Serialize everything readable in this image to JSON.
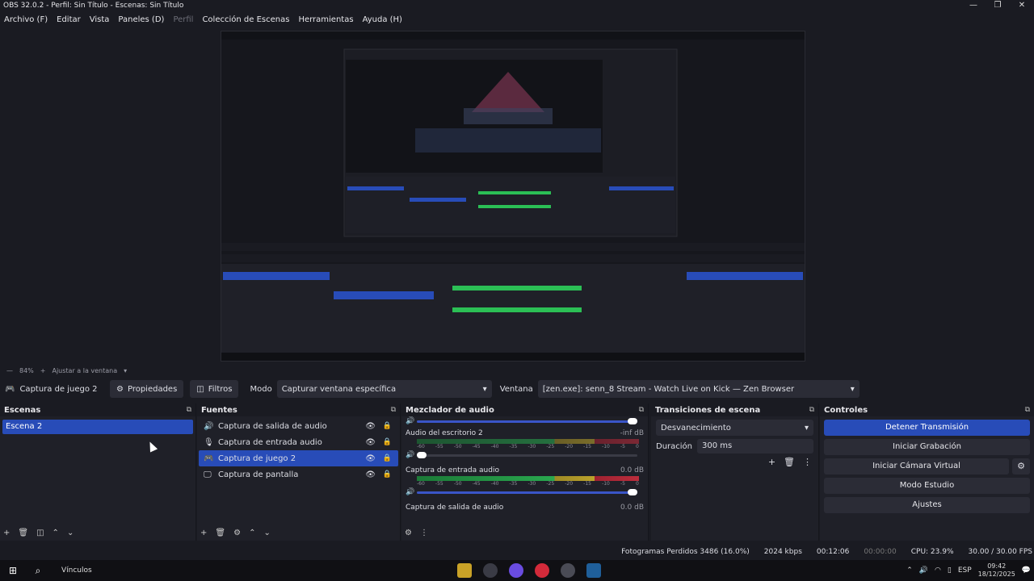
{
  "window": {
    "title": "OBS 32.0.2 - Perfil: Sin Título - Escenas: Sin Título",
    "controls": [
      "—",
      "❐",
      "✕"
    ]
  },
  "menu": [
    "Archivo (F)",
    "Editar",
    "Vista",
    "Paneles (D)",
    "Perfil",
    "Colección de Escenas",
    "Herramientas",
    "Ayuda (H)"
  ],
  "zoom_bar": {
    "zoom": "84%",
    "fit": "Ajustar a la ventana"
  },
  "context_bar": {
    "source_name": "Captura de juego 2",
    "properties_label": "Propiedades",
    "filters_label": "Filtros",
    "mode_label": "Modo",
    "mode_value": "Capturar ventana específica",
    "window_label": "Ventana",
    "window_value": "[zen.exe]: senn_8 Stream - Watch Live on Kick — Zen Browser"
  },
  "scenes": {
    "title": "Escenas",
    "items": [
      "Escena 2"
    ]
  },
  "sources": {
    "title": "Fuentes",
    "items": [
      {
        "label": "Captura de salida de audio",
        "icon": "speaker-icon"
      },
      {
        "label": "Captura de entrada audio",
        "icon": "microphone-icon"
      },
      {
        "label": "Captura de juego 2",
        "icon": "gamepad-icon"
      },
      {
        "label": "Captura de pantalla",
        "icon": "monitor-icon"
      }
    ]
  },
  "mixer": {
    "title": "Mezclador de audio",
    "scale": [
      "-60",
      "-55",
      "-50",
      "-45",
      "-40",
      "-35",
      "-30",
      "-25",
      "-20",
      "-15",
      "-10",
      "-5",
      "0"
    ],
    "channels": [
      {
        "name": "Audio del escritorio 2",
        "db": "-inf dB",
        "volume": 0.02
      },
      {
        "name": "Captura de entrada audio",
        "db": "0.0 dB",
        "volume": 1.0
      },
      {
        "name": "Captura de salida de audio",
        "db": "0.0 dB"
      }
    ]
  },
  "transitions": {
    "title": "Transiciones de escena",
    "selected": "Desvanecimiento",
    "duration_label": "Duración",
    "duration_value": "300 ms"
  },
  "controls": {
    "title": "Controles",
    "stop_stream": "Detener Transmisión",
    "start_recording": "Iniciar Grabación",
    "start_virtual_cam": "Iniciar Cámara Virtual",
    "studio_mode": "Modo Estudio",
    "settings": "Ajustes"
  },
  "status": {
    "dropped_frames": "Fotogramas Perdidos 3486 (16.0%)",
    "bitrate": "2024 kbps",
    "stream_time": "00:12:06",
    "record_time": "00:00:00",
    "cpu": "CPU: 23.9%",
    "fps": "30.00 / 30.00 FPS"
  },
  "taskbar": {
    "links": "Vínculos",
    "lang": "ESP",
    "time": "09:42",
    "date": "18/12/2025"
  },
  "colors": {
    "accent": "#284cb8",
    "panel": "#1f2028",
    "background": "#1a1b22"
  }
}
